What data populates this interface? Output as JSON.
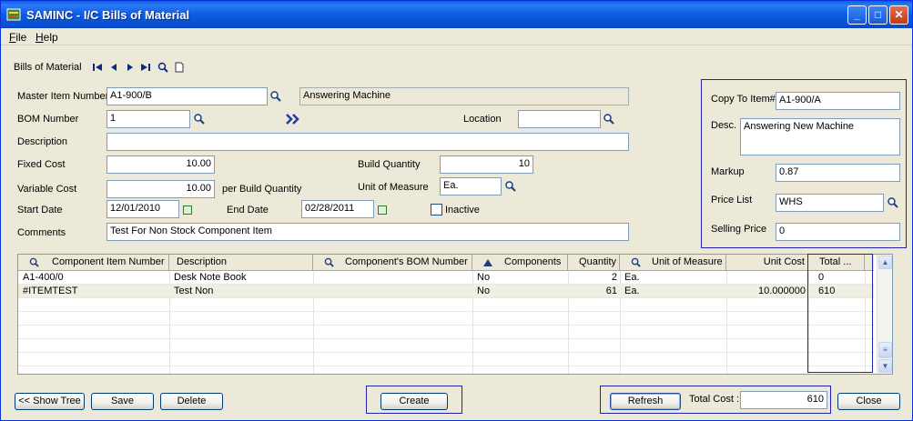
{
  "window": {
    "title": "SAMINC - I/C Bills of Material",
    "controls": {
      "minimize": "_",
      "maximize": "□",
      "close": "✕"
    }
  },
  "menu": [
    {
      "key": "F",
      "rest": "ile"
    },
    {
      "key": "H",
      "rest": "elp"
    }
  ],
  "toolbar": {
    "label": "Bills of Material"
  },
  "form": {
    "master_item_label": "Master Item Number",
    "master_item_value": "A1-900/B",
    "master_item_desc": "Answering Machine",
    "bom_number_label": "BOM Number",
    "bom_number_value": "1",
    "location_label": "Location",
    "location_value": "",
    "description_label": "Description",
    "description_value": "",
    "fixed_cost_label": "Fixed Cost",
    "fixed_cost_value": "10.00",
    "build_qty_label": "Build Quantity",
    "build_qty_value": "10",
    "variable_cost_label": "Variable Cost",
    "variable_cost_value": "10.00",
    "per_build_label": "per Build Quantity",
    "uom_label": "Unit of Measure",
    "uom_value": "Ea.",
    "start_date_label": "Start Date",
    "start_date_value": "12/01/2010",
    "end_date_label": "End Date",
    "end_date_value": "02/28/2011",
    "inactive_label": "Inactive",
    "comments_label": "Comments",
    "comments_value": "Test For Non Stock Component Item"
  },
  "copy_panel": {
    "copy_to_label": "Copy To Item#",
    "copy_to_value": "A1-900/A",
    "desc_label": "Desc.",
    "desc_value": "Answering New Machine",
    "markup_label": "Markup",
    "markup_value": "0.87",
    "price_list_label": "Price List",
    "price_list_value": "WHS",
    "selling_price_label": "Selling Price",
    "selling_price_value": "0"
  },
  "grid": {
    "headers": {
      "component": "Component Item Number",
      "description": "Description",
      "comp_bom": "Component's BOM Number",
      "components": "Components",
      "quantity": "Quantity",
      "uom": "Unit of Measure",
      "unit_cost": "Unit Cost",
      "total": "Total ..."
    },
    "rows": [
      {
        "component": "A1-400/0",
        "description": "Desk Note Book",
        "comp_bom": "",
        "components": "No",
        "quantity": "2",
        "uom": "Ea.",
        "unit_cost": "",
        "total": "0"
      },
      {
        "component": "#ITEMTEST",
        "description": "Test Non",
        "comp_bom": "",
        "components": "No",
        "quantity": "61",
        "uom": "Ea.",
        "unit_cost": "10.000000",
        "total": "610"
      }
    ]
  },
  "buttons": {
    "show_tree": "<< Show Tree",
    "save": "Save",
    "delete": "Delete",
    "create": "Create",
    "refresh": "Refresh",
    "close": "Close"
  },
  "total_cost": {
    "label": "Total Cost :",
    "value": "610"
  },
  "colors": {
    "title_bar": "#0A5FE9",
    "highlight_box": "#2222AA",
    "selected_row": "#F1EFE2"
  }
}
